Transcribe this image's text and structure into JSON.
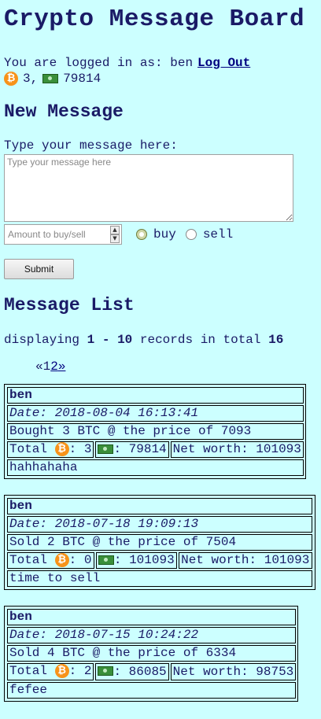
{
  "title": "Crypto Message Board",
  "login": {
    "prefix": "You are logged in as: ben",
    "logout": "Log Out"
  },
  "holdings": {
    "btc": "3,",
    "cash": "79814"
  },
  "new_message": {
    "heading": "New Message",
    "prompt": "Type your message here:",
    "placeholder": "Type your message here",
    "amount_placeholder": "Amount to buy/sell",
    "buy": "buy",
    "sell": "sell",
    "submit": "Submit"
  },
  "list": {
    "heading": "Message List",
    "display_prefix": "displaying",
    "range_start": "1",
    "range_sep": "-",
    "range_end": "10",
    "total_label": "records in total",
    "total": "16",
    "pager": {
      "prev": "«",
      "page1": "1",
      "page2": "2",
      "next": "»"
    }
  },
  "messages": [
    {
      "user": "ben",
      "date": "Date: 2018-08-04 16:13:41",
      "action": "Bought 3 BTC @ the price of 7093",
      "total_label": "Total",
      "btc": ": 3",
      "cash": ": 79814",
      "net": "Net worth: 101093",
      "note": "hahhahaha"
    },
    {
      "user": "ben",
      "date": "Date: 2018-07-18 19:09:13",
      "action": "Sold 2 BTC @ the price of 7504",
      "total_label": "Total",
      "btc": ": 0",
      "cash": ": 101093",
      "net": "Net worth: 101093",
      "note": "time to sell"
    },
    {
      "user": "ben",
      "date": "Date: 2018-07-15 10:24:22",
      "action": "Sold 4 BTC @ the price of 6334",
      "total_label": "Total",
      "btc": ": 2",
      "cash": ": 86085",
      "net": "Net worth: 98753",
      "note": "fefee"
    }
  ]
}
